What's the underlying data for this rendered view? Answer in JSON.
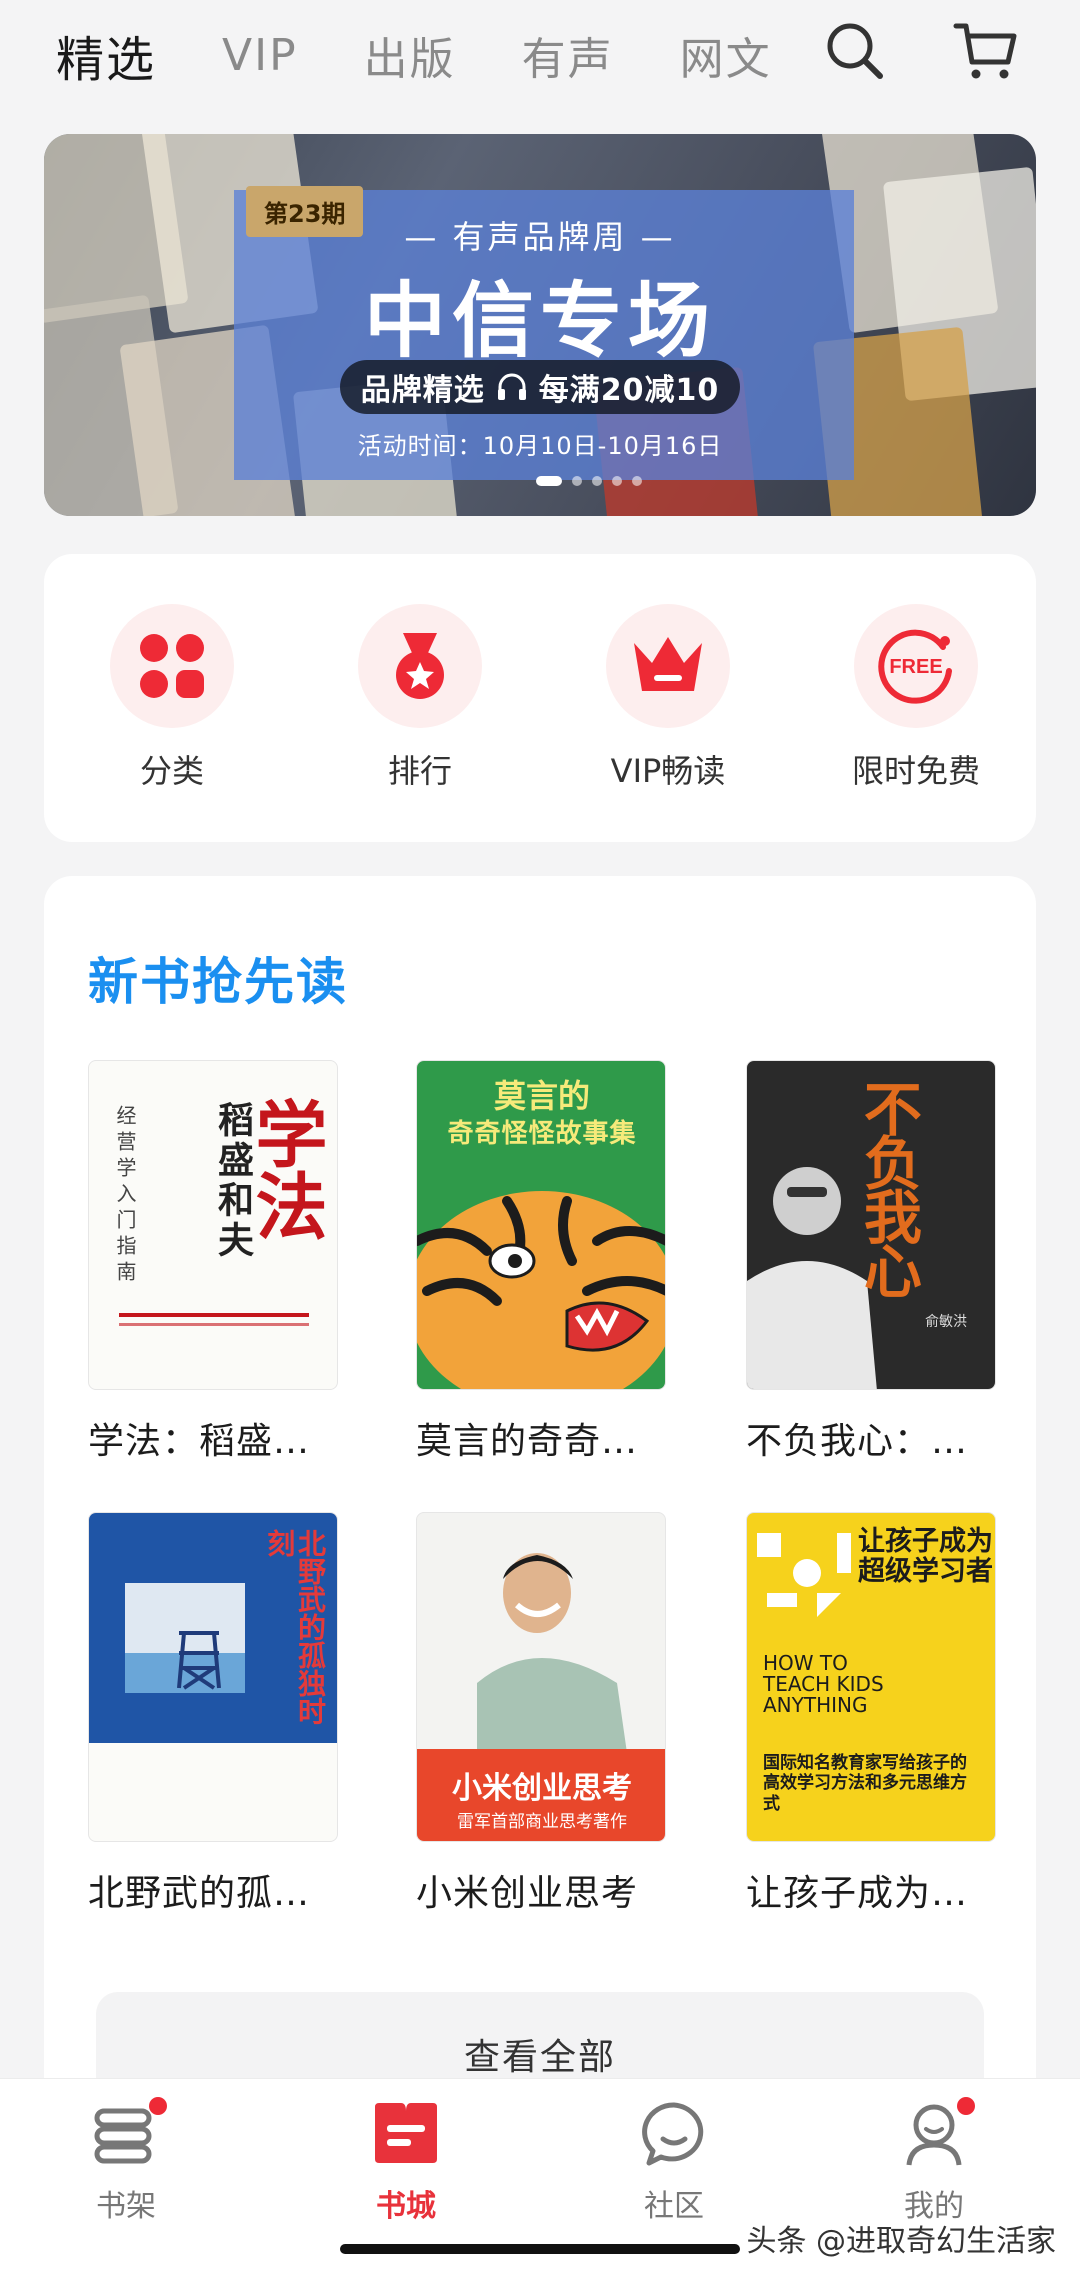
{
  "top_nav": {
    "tabs": [
      "精选",
      "VIP",
      "出版",
      "有声",
      "网文"
    ],
    "active": "精选",
    "search_icon": "search-icon",
    "cart_icon": "cart-icon"
  },
  "banner": {
    "issue": "第23期",
    "subtitle": "— 有声品牌周 —",
    "title": "中信专场",
    "promo_left": "品牌精选",
    "promo_right": "每满20减10",
    "date": "活动时间：10月10日-10月16日",
    "slides": 5,
    "active_slide": 0
  },
  "quick_entries": [
    {
      "label": "分类",
      "icon": "category-icon"
    },
    {
      "label": "排行",
      "icon": "medal-icon"
    },
    {
      "label": "VIP畅读",
      "icon": "crown-icon"
    },
    {
      "label": "限时免费",
      "icon": "free-icon",
      "icon_text": "FREE"
    }
  ],
  "new_books": {
    "heading": "新书抢先读",
    "books": [
      {
        "title": "学法：稻盛…",
        "cover_main": "学法",
        "cover_side": "稻盛和夫",
        "cover_sub": "经营学入门指南"
      },
      {
        "title": "莫言的奇奇…",
        "cover_main": "莫言的",
        "cover_sub": "奇奇怪怪故事集"
      },
      {
        "title": "不负我心：…",
        "cover_main": "不负我心",
        "cover_author": "俞敏洪"
      },
      {
        "title": "北野武的孤…",
        "cover_main": "北野武的孤独时刻"
      },
      {
        "title": "小米创业思考",
        "cover_main": "小米创业思考",
        "cover_sub": "雷军首部商业思考著作"
      },
      {
        "title": "让孩子成为…",
        "cover_main": "让孩子成为超级学习者",
        "cover_en": "HOW TO TEACH KIDS ANYTHING",
        "cover_sub": "国际知名教育家写给孩子的高效学习方法和多元思维方式"
      }
    ],
    "view_all": "查看全部"
  },
  "tab_bar": {
    "items": [
      {
        "label": "书架",
        "icon": "bookshelf-icon",
        "badge": true
      },
      {
        "label": "书城",
        "icon": "bookstore-icon",
        "badge": false
      },
      {
        "label": "社区",
        "icon": "chat-icon",
        "badge": false
      },
      {
        "label": "我的",
        "icon": "profile-icon",
        "badge": true
      }
    ],
    "active": "书城"
  },
  "watermark": "头条 @进取奇幻生活家",
  "colors": {
    "accent_red": "#e8323b",
    "heading_blue": "#1a8ff0",
    "banner_panel": "#5b80d6"
  }
}
